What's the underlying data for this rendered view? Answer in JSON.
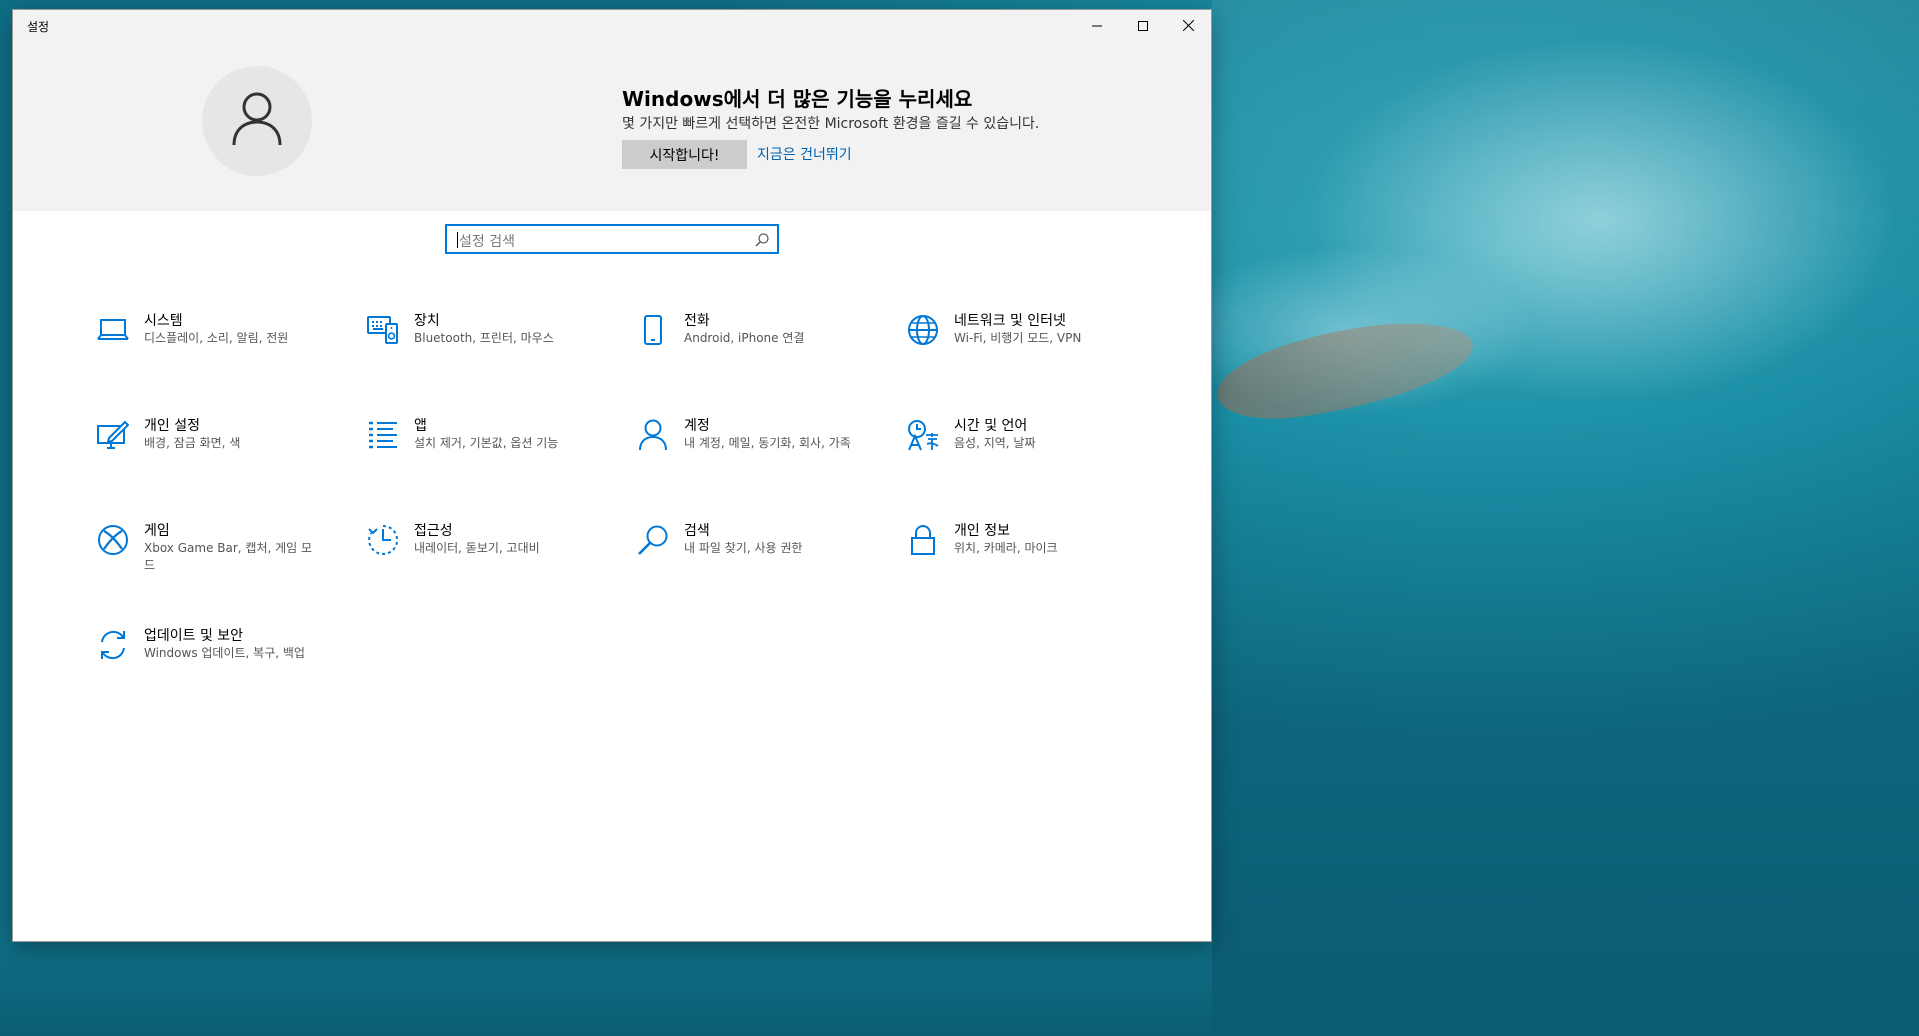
{
  "window": {
    "title": "설정",
    "controls": {
      "minimize": "minimize",
      "maximize": "maximize",
      "close": "close"
    }
  },
  "hero": {
    "title": "Windows에서 더 많은 기능을 누리세요",
    "subtitle": "몇 가지만 빠르게 선택하면 온전한 Microsoft 환경을 즐길 수 있습니다.",
    "start_button": "시작합니다!",
    "skip_link": "지금은 건너뛰기"
  },
  "search": {
    "placeholder": "설정 검색",
    "icon": "search-icon"
  },
  "categories": [
    {
      "name": "시스템",
      "desc": "디스플레이, 소리, 알림, 전원",
      "icon": "laptop-icon"
    },
    {
      "name": "장치",
      "desc": "Bluetooth, 프린터, 마우스",
      "icon": "devices-icon"
    },
    {
      "name": "전화",
      "desc": "Android, iPhone 연결",
      "icon": "phone-icon"
    },
    {
      "name": "네트워크 및 인터넷",
      "desc": "Wi-Fi, 비행기 모드, VPN",
      "icon": "globe-icon"
    },
    {
      "name": "개인 설정",
      "desc": "배경, 잠금 화면, 색",
      "icon": "personalization-icon"
    },
    {
      "name": "앱",
      "desc": "설치 제거, 기본값, 옵션 기능",
      "icon": "apps-list-icon"
    },
    {
      "name": "계정",
      "desc": "내 계정, 메일, 동기화, 회사, 가족",
      "icon": "person-icon"
    },
    {
      "name": "시간 및 언어",
      "desc": "음성, 지역, 날짜",
      "icon": "time-language-icon"
    },
    {
      "name": "게임",
      "desc": "Xbox Game Bar, 캡처, 게임 모드",
      "icon": "xbox-icon"
    },
    {
      "name": "접근성",
      "desc": "내레이터, 돋보기, 고대비",
      "icon": "ease-of-access-icon"
    },
    {
      "name": "검색",
      "desc": "내 파일 찾기, 사용 권한",
      "icon": "search-icon"
    },
    {
      "name": "개인 정보",
      "desc": "위치, 카메라, 마이크",
      "icon": "lock-icon"
    },
    {
      "name": "업데이트 및 보안",
      "desc": "Windows 업데이트, 복구, 백업",
      "icon": "sync-icon"
    }
  ],
  "colors": {
    "accent": "#0078d7",
    "link": "#0063b1",
    "hero_bg": "#f2f2f2"
  }
}
